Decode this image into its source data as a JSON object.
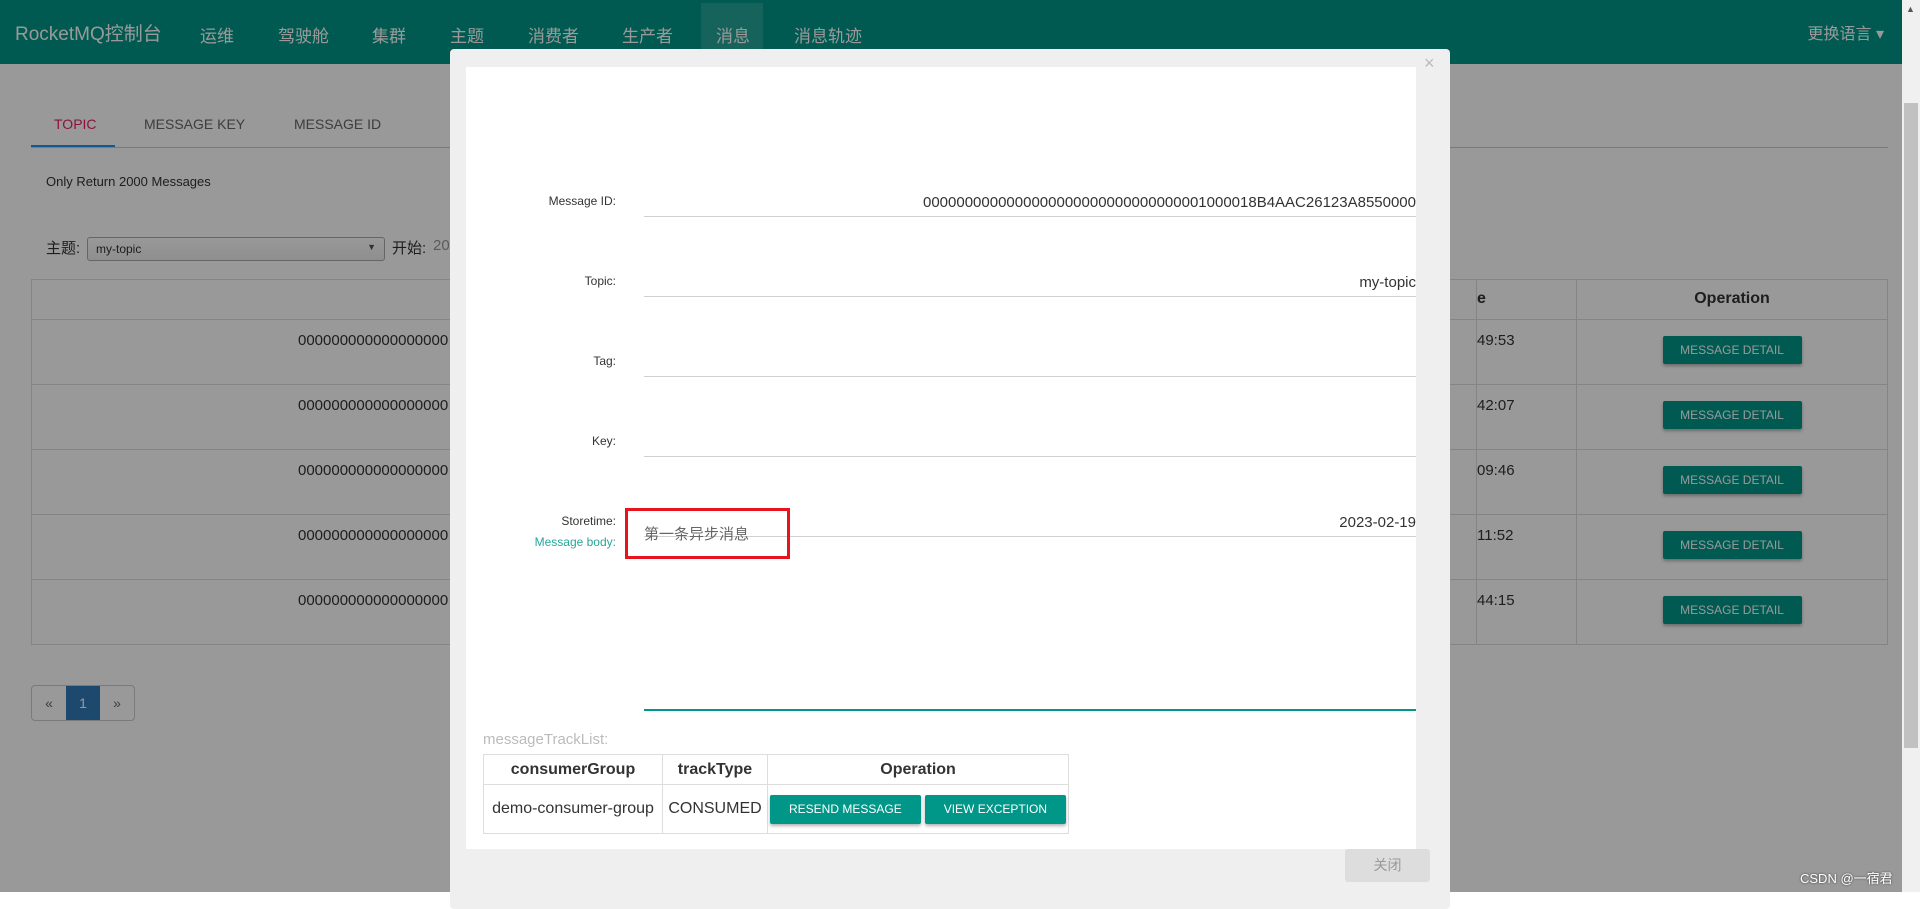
{
  "nav": {
    "brand": "RocketMQ控制台",
    "items": [
      "运维",
      "驾驶舱",
      "集群",
      "主题",
      "消费者",
      "生产者",
      "消息",
      "消息轨迹"
    ],
    "active": "消息",
    "language": "更换语言 ▾"
  },
  "tabs": [
    "TOPIC",
    "MESSAGE KEY",
    "MESSAGE ID"
  ],
  "note": "Only Return 2000 Messages",
  "filter": {
    "topic_label": "主题:",
    "topic_value": "my-topic",
    "start_label": "开始:",
    "start_value": "20"
  },
  "table": {
    "headers": {
      "time_partial": "e",
      "operation": "Operation"
    },
    "rows": [
      {
        "id": "000000000000000000",
        "time": "49:53",
        "button": "MESSAGE DETAIL"
      },
      {
        "id": "000000000000000000",
        "time": "42:07",
        "button": "MESSAGE DETAIL"
      },
      {
        "id": "000000000000000000",
        "time": "09:46",
        "button": "MESSAGE DETAIL"
      },
      {
        "id": "000000000000000000",
        "time": "11:52",
        "button": "MESSAGE DETAIL"
      },
      {
        "id": "000000000000000000",
        "time": "44:15",
        "button": "MESSAGE DETAIL"
      }
    ]
  },
  "pagination": {
    "prev": "«",
    "current": "1",
    "next": "»"
  },
  "modal": {
    "close_icon": "×",
    "fields": [
      {
        "label": "Message ID:",
        "value": "0000000000000000000000000000000001000018B4AAC26123A8550000"
      },
      {
        "label": "Topic:",
        "value": "my-topic"
      },
      {
        "label": "Tag:",
        "value": ""
      },
      {
        "label": "Key:",
        "value": ""
      },
      {
        "label": "Storetime:",
        "value": "2023-02-19"
      }
    ],
    "body_label": "Message body:",
    "body": "第一条异步消息",
    "track_label": "messageTrackList:",
    "track_headers": [
      "consumerGroup",
      "trackType",
      "Operation"
    ],
    "track_rows": [
      {
        "consumerGroup": "demo-consumer-group",
        "trackType": "CONSUMED",
        "resend": "RESEND MESSAGE",
        "view": "VIEW EXCEPTION"
      }
    ],
    "close_button": "关闭"
  },
  "watermark": "CSDN @一宿君",
  "colors": {
    "primary": "#009688",
    "highlight": "#e8141d",
    "active_tab": "#e91e63"
  }
}
